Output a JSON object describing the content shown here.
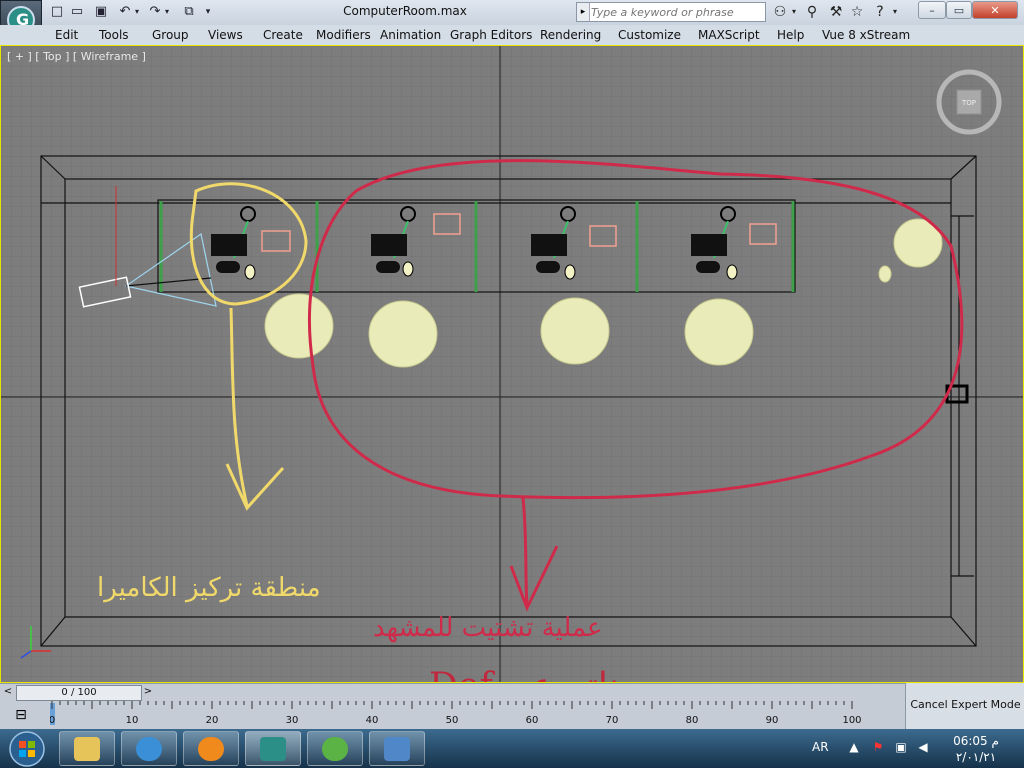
{
  "window": {
    "title": "ComputerRoom.max",
    "search_placeholder": "Type a keyword or phrase"
  },
  "menu": [
    "Edit",
    "Tools",
    "Group",
    "Views",
    "Create",
    "Modifiers",
    "Animation",
    "Graph Editors",
    "Rendering",
    "Customize",
    "MAXScript",
    "Help",
    "Vue 8 xStream"
  ],
  "viewport": {
    "label": "[ + ] [ Top ] [ Wireframe ]",
    "viewcube_label": "TOP",
    "annotation_focus": "منطقة تركيز الكاميرا",
    "annotation_blur": "عملية تشتيت للمشهد",
    "annotation_dof": "ناتج عن Dof",
    "colors": {
      "focus": "#f0d96a",
      "blur": "#d02a4a",
      "grid": "#6a6a6a",
      "bg": "#7d7d7d"
    }
  },
  "timeline": {
    "frame_display": "0 / 100",
    "ruler_labels": [
      "0",
      "10",
      "20",
      "30",
      "40",
      "50",
      "60",
      "70",
      "80",
      "90",
      "100"
    ]
  },
  "status": {
    "cancel_expert_label": "Cancel Expert Mode"
  },
  "taskbar": {
    "language": "AR",
    "clock_time": "06:05 م",
    "clock_date": "٢/٠١/٢١",
    "apps": [
      "explorer",
      "internet-explorer",
      "media-player",
      "3ds-max",
      "live-messenger",
      "photo-viewer"
    ]
  }
}
